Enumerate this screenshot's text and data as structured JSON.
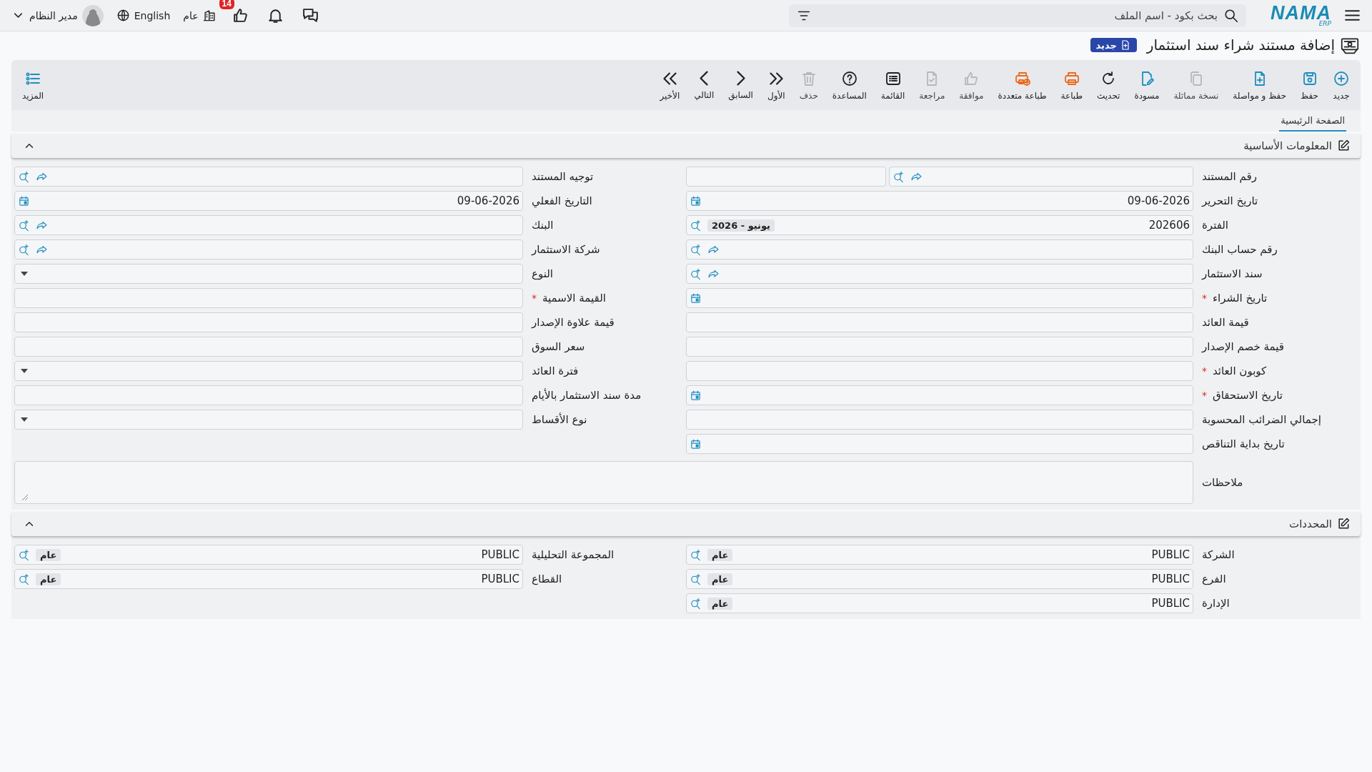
{
  "topbar": {
    "logo": {
      "name": "NAMA",
      "sub": "ERP"
    },
    "search": {
      "placeholder": "بحث بكود - اسم الملف"
    },
    "likes_badge": "14",
    "company": "عام",
    "language": "English",
    "user": "مدير النظام"
  },
  "page_title": {
    "text": "إضافة مستند شراء سند استثمار",
    "badge": "جديد"
  },
  "toolbar": {
    "buttons": [
      {
        "label": "جديد",
        "kind": "new",
        "disabled": false
      },
      {
        "label": "حفظ",
        "kind": "save",
        "disabled": false
      },
      {
        "label": "حفظ و مواصلة",
        "kind": "save_continue",
        "disabled": false
      },
      {
        "label": "نسخة مماثلة",
        "kind": "duplicate",
        "disabled": true
      },
      {
        "label": "مسودة",
        "kind": "draft",
        "disabled": false
      },
      {
        "label": "تحديث",
        "kind": "refresh",
        "disabled": false
      },
      {
        "label": "طباعة",
        "kind": "print",
        "disabled": false
      },
      {
        "label": "طباعة متعددة",
        "kind": "multi_print",
        "disabled": false
      },
      {
        "label": "موافقة",
        "kind": "approve",
        "disabled": true
      },
      {
        "label": "مراجعة",
        "kind": "review",
        "disabled": true
      },
      {
        "label": "القائمة",
        "kind": "list",
        "disabled": false
      },
      {
        "label": "المساعدة",
        "kind": "help",
        "disabled": false
      },
      {
        "label": "حذف",
        "kind": "delete",
        "disabled": true
      },
      {
        "label": "الأول",
        "kind": "first",
        "disabled": false
      },
      {
        "label": "السابق",
        "kind": "previous",
        "disabled": false
      },
      {
        "label": "التالي",
        "kind": "next",
        "disabled": false
      },
      {
        "label": "الأخير",
        "kind": "last",
        "disabled": false
      }
    ],
    "more": "المزيد"
  },
  "tabs": [
    {
      "label": "الصفحة الرئيسية",
      "selected": true
    }
  ],
  "sections": [
    {
      "title": "المعلومات الأساسية",
      "expanded": true,
      "columns": [
        [
          {
            "label": "رقم المستند",
            "kind": "doc_number"
          },
          {
            "label": "تاريخ التحرير",
            "kind": "date",
            "value": "09-06-2026"
          },
          {
            "label": "الفترة",
            "kind": "lookup_chip",
            "value": "202606",
            "chip": "يونيو - 2026"
          },
          {
            "label": "رقم حساب البنك",
            "kind": "lookup"
          },
          {
            "label": "سند الاستثمار",
            "kind": "lookup"
          },
          {
            "label": "تاريخ الشراء",
            "kind": "date",
            "required_mark": "*"
          },
          {
            "label": "قيمة العائد",
            "kind": "text"
          },
          {
            "label": "قيمة خصم الإصدار",
            "kind": "text"
          },
          {
            "label": "كوبون العائد",
            "kind": "text",
            "required_mark": "*"
          },
          {
            "label": "تاريخ الاستحقاق",
            "kind": "date",
            "required_mark": "*"
          },
          {
            "label": "إجمالي الضرائب المحسوبة",
            "kind": "text"
          },
          {
            "label": "تاريخ بداية التناقص",
            "kind": "date"
          }
        ],
        [
          {
            "label": "توجيه المستند",
            "kind": "lookup"
          },
          {
            "label": "التاريخ الفعلي",
            "kind": "date",
            "value": "09-06-2026"
          },
          {
            "label": "البنك",
            "kind": "lookup"
          },
          {
            "label": "شركة الاستثمار",
            "kind": "lookup"
          },
          {
            "label": "النوع",
            "kind": "select"
          },
          {
            "label": "القيمة الاسمية",
            "kind": "text",
            "required_mark": "*"
          },
          {
            "label": "قيمة علاوة الإصدار",
            "kind": "text"
          },
          {
            "label": "سعر السوق",
            "kind": "text"
          },
          {
            "label": "فترة العائد",
            "kind": "select"
          },
          {
            "label": "مدة سند الاستثمار بالأيام",
            "kind": "text"
          },
          {
            "label": "نوع الأقساط",
            "kind": "select"
          }
        ]
      ],
      "notes": {
        "label": "ملاحظات"
      }
    },
    {
      "title": "المحددات",
      "expanded": true,
      "columns": [
        [
          {
            "label": "الشركة",
            "kind": "lookup_chip",
            "value": "PUBLIC",
            "chip": "عام"
          },
          {
            "label": "الفرع",
            "kind": "lookup_chip",
            "value": "PUBLIC",
            "chip": "عام"
          },
          {
            "label": "الإدارة",
            "kind": "lookup_chip",
            "value": "PUBLIC",
            "chip": "عام"
          }
        ],
        [
          {
            "label": "المجموعة التحليلية",
            "kind": "lookup_chip",
            "value": "PUBLIC",
            "chip": "عام"
          },
          {
            "label": "القطاع",
            "kind": "lookup_chip",
            "value": "PUBLIC",
            "chip": "عام"
          }
        ]
      ]
    }
  ]
}
